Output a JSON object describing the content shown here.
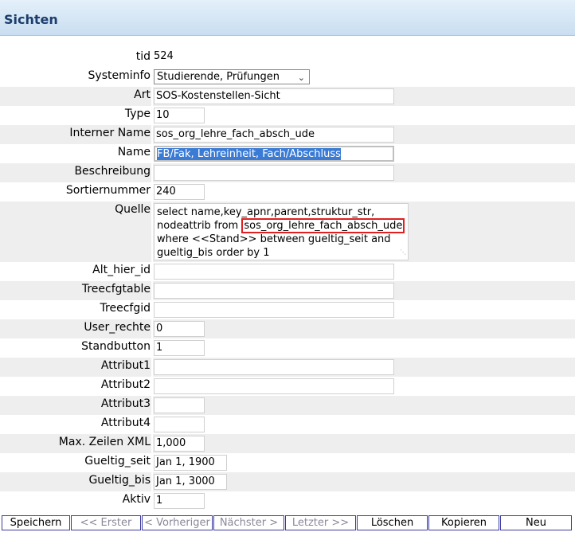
{
  "header": {
    "title": "Sichten"
  },
  "fields": {
    "tid": {
      "label": "tid",
      "value": "524"
    },
    "systeminfo": {
      "label": "Systeminfo",
      "value": "Studierende, Prüfungen"
    },
    "art": {
      "label": "Art",
      "value": "SOS-Kostenstellen-Sicht"
    },
    "type": {
      "label": "Type",
      "value": "10"
    },
    "interner_name": {
      "label": "Interner Name",
      "value": "sos_org_lehre_fach_absch_ude"
    },
    "name": {
      "label": "Name",
      "value": "FB/Fak, Lehreinheit, Fach/Abschluss"
    },
    "beschreibung": {
      "label": "Beschreibung",
      "value": ""
    },
    "sortiernummer": {
      "label": "Sortiernummer",
      "value": "240"
    },
    "quelle": {
      "label": "Quelle",
      "line1": "select name,key_apnr,parent,struktur_str,",
      "line2_prefix": "nodeattrib from ",
      "line2_highlight": "sos_org_lehre_fach_absch_ude",
      "line3": "where <<Stand>> between gueltig_seit and",
      "line4": "gueltig_bis order by 1"
    },
    "alt_hier_id": {
      "label": "Alt_hier_id",
      "value": ""
    },
    "treecfgtable": {
      "label": "Treecfgtable",
      "value": ""
    },
    "treecfgid": {
      "label": "Treecfgid",
      "value": ""
    },
    "user_rechte": {
      "label": "User_rechte",
      "value": "0"
    },
    "standbutton": {
      "label": "Standbutton",
      "value": "1"
    },
    "attribut1": {
      "label": "Attribut1",
      "value": ""
    },
    "attribut2": {
      "label": "Attribut2",
      "value": ""
    },
    "attribut3": {
      "label": "Attribut3",
      "value": ""
    },
    "attribut4": {
      "label": "Attribut4",
      "value": ""
    },
    "max_zeilen_xml": {
      "label": "Max. Zeilen XML",
      "value": "1,000"
    },
    "gueltig_seit": {
      "label": "Gueltig_seit",
      "value": "Jan 1, 1900"
    },
    "gueltig_bis": {
      "label": "Gueltig_bis",
      "value": "Jan 1, 3000"
    },
    "aktiv": {
      "label": "Aktiv",
      "value": "1"
    }
  },
  "buttons": {
    "speichern": "Speichern",
    "erster": "<< Erster",
    "vorheriger": "< Vorheriger",
    "naechster": "Nächster >",
    "letzter": "Letzter >>",
    "loeschen": "Löschen",
    "kopieren": "Kopieren",
    "neu": "Neu"
  }
}
